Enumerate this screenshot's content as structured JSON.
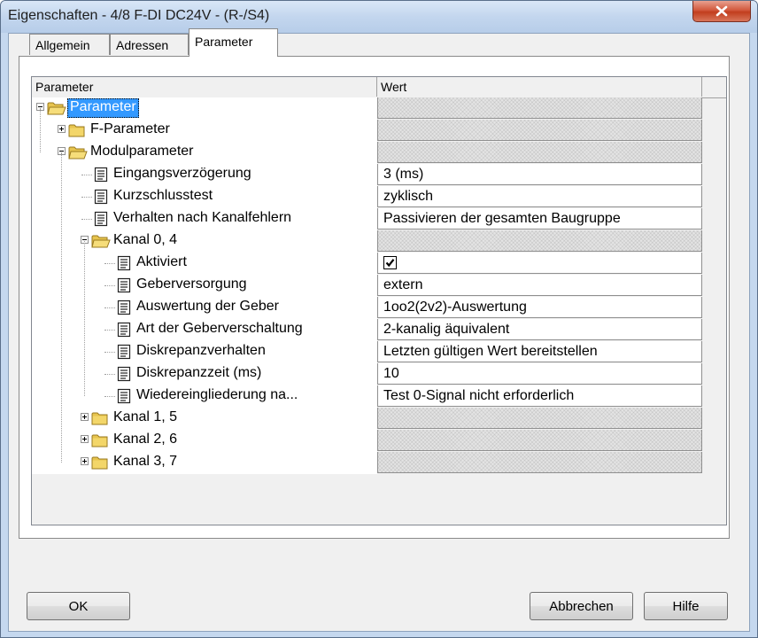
{
  "window": {
    "title": "Eigenschaften - 4/8 F-DI DC24V - (R-/S4)"
  },
  "tabs": [
    {
      "label": "Allgemein"
    },
    {
      "label": "Adressen"
    },
    {
      "label": "Parameter"
    }
  ],
  "grid": {
    "columns": [
      {
        "label": "Parameter"
      },
      {
        "label": "Wert"
      }
    ],
    "rows": [
      {
        "label": "Parameter",
        "value": "",
        "type": "folder",
        "selected": true
      },
      {
        "label": "F-Parameter",
        "value": "",
        "type": "folder",
        "collapsed": true
      },
      {
        "label": "Modulparameter",
        "value": "",
        "type": "folder"
      },
      {
        "label": "Eingangsverzögerung",
        "value": "3 (ms)",
        "type": "item"
      },
      {
        "label": "Kurzschlusstest",
        "value": "zyklisch",
        "type": "item"
      },
      {
        "label": "Verhalten nach Kanalfehlern",
        "value": "Passivieren der gesamten Baugruppe",
        "type": "item"
      },
      {
        "label": "Kanal 0, 4",
        "value": "",
        "type": "folder"
      },
      {
        "label": "Aktiviert",
        "value": "",
        "type": "item",
        "checkbox": true,
        "checked": true
      },
      {
        "label": "Geberversorgung",
        "value": "extern",
        "type": "item"
      },
      {
        "label": "Auswertung der Geber",
        "value": "1oo2(2v2)-Auswertung",
        "type": "item"
      },
      {
        "label": "Art der Geberverschaltung",
        "value": "2-kanalig äquivalent",
        "type": "item"
      },
      {
        "label": "Diskrepanzverhalten",
        "value": "Letzten gültigen Wert bereitstellen",
        "type": "item"
      },
      {
        "label": "Diskrepanzzeit (ms)",
        "value": "10",
        "type": "item"
      },
      {
        "label": "Wiedereingliederung na...",
        "value": "Test 0-Signal nicht erforderlich",
        "type": "item"
      },
      {
        "label": "Kanal 1, 5",
        "value": "",
        "type": "folder",
        "collapsed": true
      },
      {
        "label": "Kanal 2, 6",
        "value": "",
        "type": "folder",
        "collapsed": true
      },
      {
        "label": "Kanal 3, 7",
        "value": "",
        "type": "folder",
        "collapsed": true
      }
    ]
  },
  "buttons": {
    "ok": "OK",
    "cancel": "Abbrechen",
    "help": "Hilfe"
  },
  "icons": {
    "close": "close-icon",
    "folder": "folder-icon",
    "document": "document-icon",
    "expander": "expander-icon",
    "checkbox": "checkbox-icon"
  },
  "colors": {
    "selection": "#3399ff",
    "close_button": "#c23e1e",
    "title_gradient": "#c3d6ee"
  }
}
